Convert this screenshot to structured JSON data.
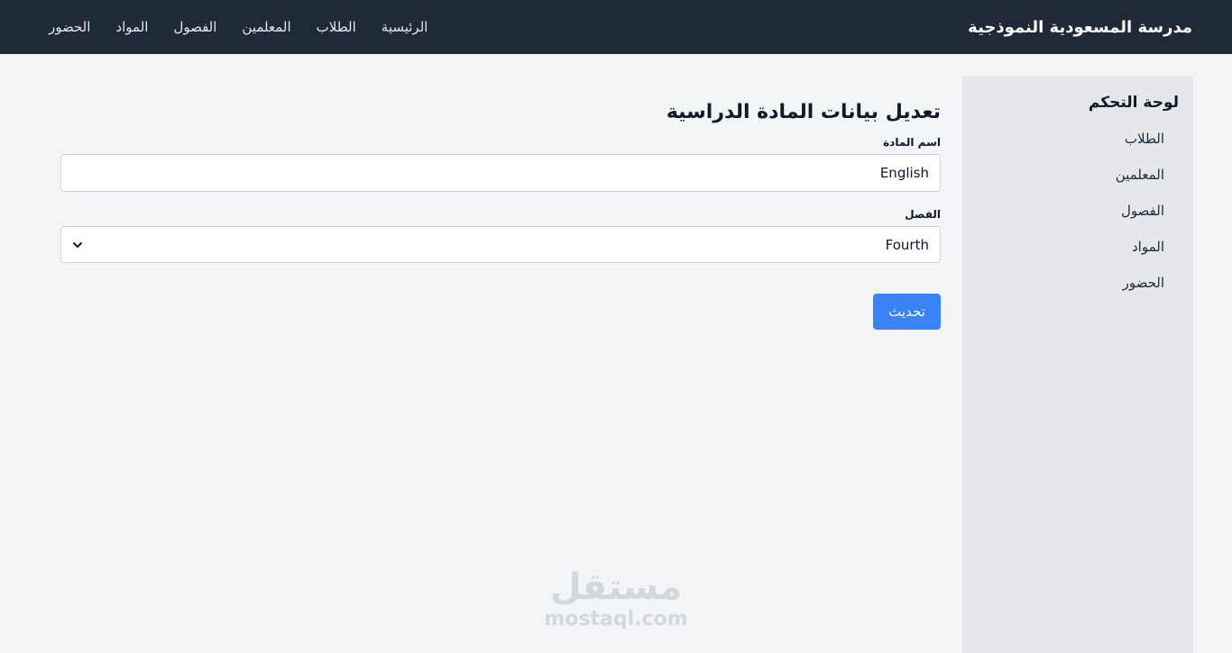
{
  "header": {
    "brand": "مدرسة المسعودية النموذجية",
    "nav": [
      "الرئيسية",
      "الطلاب",
      "المعلمين",
      "الفصول",
      "المواد",
      "الحضور"
    ]
  },
  "sidebar": {
    "title": "لوحة التحكم",
    "items": [
      "الطلاب",
      "المعلمين",
      "الفصول",
      "المواد",
      "الحضور"
    ]
  },
  "form": {
    "title": "تعديل بيانات المادة الدراسية",
    "subject_label": "اسم المادة",
    "subject_value": "English",
    "class_label": "الفصل",
    "class_value": "Fourth",
    "submit_label": "تحديث"
  },
  "watermark": {
    "arabic": "مستقل",
    "latin": "mostaql.com"
  },
  "colors": {
    "nav_bg": "#1f2937",
    "sidebar_bg": "#e5e7eb",
    "page_bg": "#f3f4f6",
    "button_bg": "#3b82f6"
  }
}
